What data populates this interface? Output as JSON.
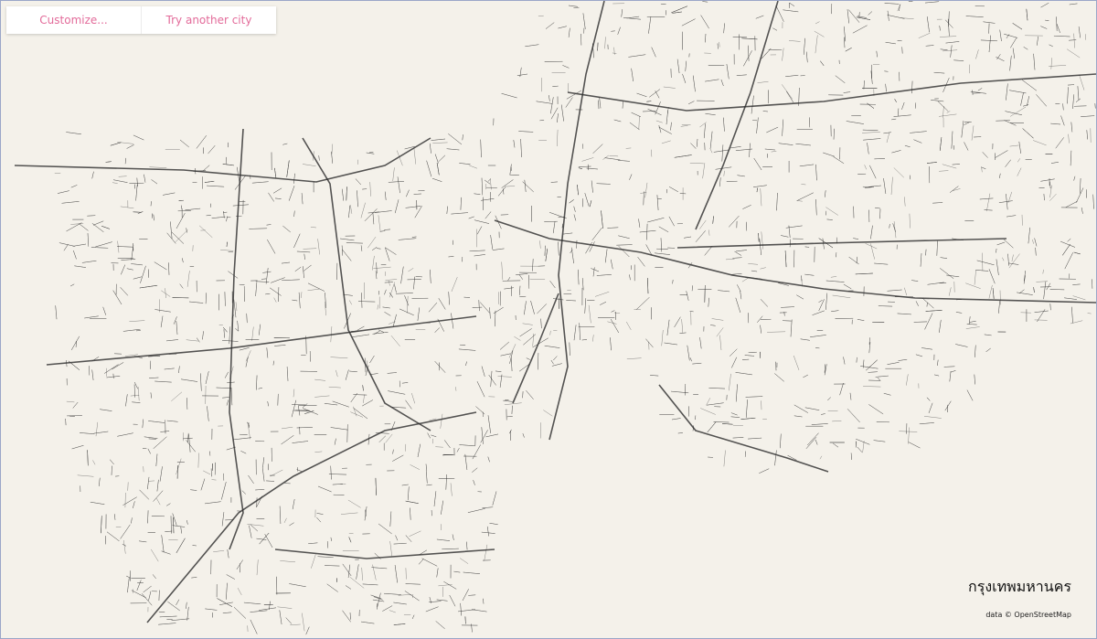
{
  "toolbar": {
    "customize_label": "Customize...",
    "try_another_label": "Try another city"
  },
  "map": {
    "city_name": "กรุงเทพมหานคร",
    "attribution": "data © OpenStreetMap",
    "background_color": "#f4f1ea",
    "road_color": "#2b2b2b",
    "accent_color": "#e36b9a"
  }
}
